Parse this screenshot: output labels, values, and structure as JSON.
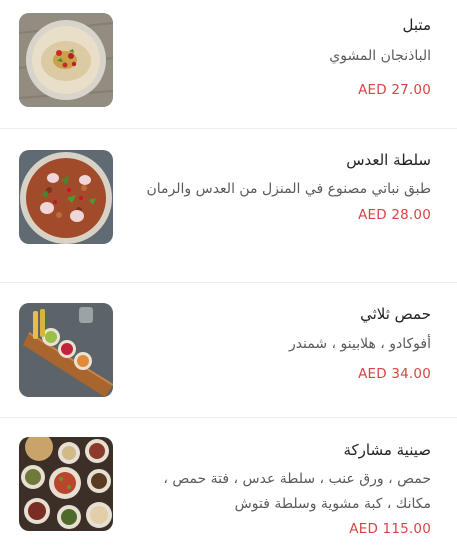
{
  "menu": {
    "items": [
      {
        "title": "متبل",
        "description": "الباذنجان المشوي",
        "price": "AED 27.00",
        "image": "mutabal-dish-photo"
      },
      {
        "title": "سلطة العدس",
        "description": "طبق نباتي مصنوع في المنزل من العدس والرمان",
        "price": "AED 28.00",
        "image": "lentil-salad-photo"
      },
      {
        "title": "حمص ثلاثي",
        "description": "أفوكادو ، هلابينو ، شمندر",
        "price": "AED 34.00",
        "image": "hummus-trio-photo"
      },
      {
        "title": "صينية مشاركة",
        "description": "حمص ، ورق عنب ، سلطة عدس ، فتة حمص ، مكانك ، كبة مشوية وسلطة فتوش",
        "price": "AED 115.00",
        "image": "sharing-platter-photo"
      }
    ],
    "colors": {
      "price": "#d64545",
      "title": "#222222",
      "description": "#5b5b5b",
      "divider": "#ececec"
    }
  }
}
